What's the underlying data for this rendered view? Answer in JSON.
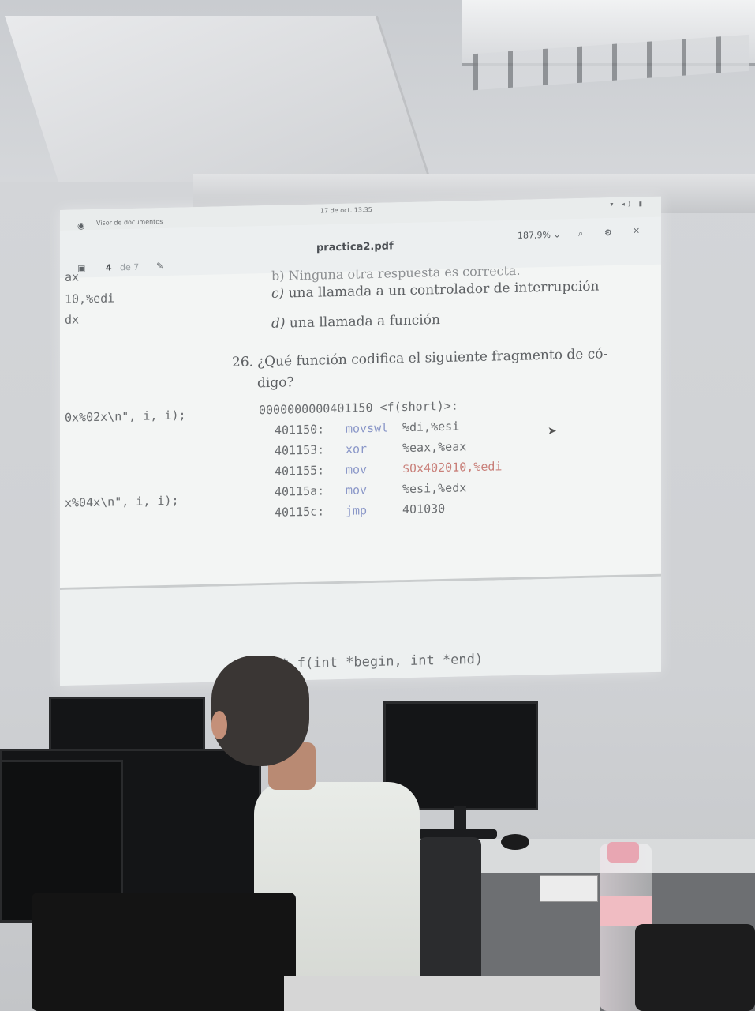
{
  "topbar": {
    "app_name": "Visor de documentos",
    "clock": "17 de oct. 13:35",
    "tray": "▾ ◂) ▮"
  },
  "toolbar": {
    "doc_title": "practica2.pdf",
    "page_current": "4",
    "page_of": "de 7",
    "zoom": "187,9% ⌄"
  },
  "document": {
    "cut_line": "b) Ninguna otra respuesta es correcta.",
    "option_c_label": "c)",
    "option_c_text": "una llamada a un controlador de interrupción",
    "option_d_label": "d)",
    "option_d_text": "una llamada a función",
    "question_number": "26.",
    "question_line1": "¿Qué función codifica el siguiente fragmento de có-",
    "question_line2": "digo?",
    "func_header": "0000000000401150 <f(short)>:",
    "asm": [
      {
        "addr": "401150:",
        "op": "movswl",
        "args": "%di,%esi"
      },
      {
        "addr": "401153:",
        "op": "xor",
        "args": "%eax,%eax"
      },
      {
        "addr": "401155:",
        "op": "mov",
        "args": "$0x402010,%edi"
      },
      {
        "addr": "40115a:",
        "op": "mov",
        "args": "%esi,%edx"
      },
      {
        "addr": "40115c:",
        "op": "jmp",
        "args": "401030"
      }
    ],
    "left_col": [
      "ax",
      "10,%edi",
      "dx",
      "0x%02x\\n\", i, i);",
      "x%04x\\n\", i, i);"
    ],
    "lower_code": "nt f(int *begin, int *end)"
  }
}
